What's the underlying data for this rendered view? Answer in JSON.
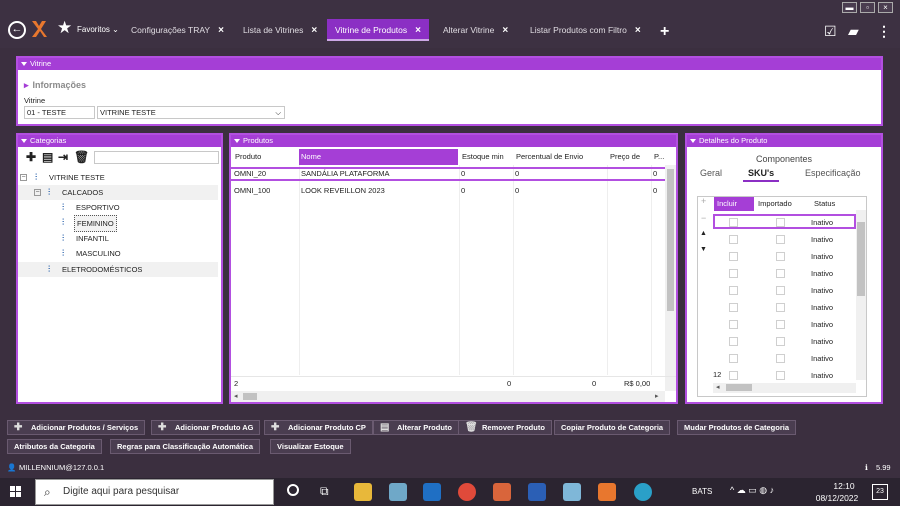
{
  "tabs": {
    "favorites": "Favoritos",
    "items": [
      {
        "label": "Configurações TRAY",
        "close": "×"
      },
      {
        "label": "Lista de Vitrines",
        "close": "×"
      },
      {
        "label": "Vitrine de Produtos",
        "close": "×"
      },
      {
        "label": "Alterar Vitrine",
        "close": "×"
      },
      {
        "label": "Listar Produtos com Filtro",
        "close": "×"
      }
    ],
    "new_tab": "+"
  },
  "window_controls": {
    "minimize": "▬",
    "restore": "▫",
    "close": "×"
  },
  "vitrine": {
    "header": "Vitrine",
    "section": "Informações",
    "label": "Vitrine",
    "code": "01 - TESTE",
    "name": "VITRINE TESTE",
    "dropdown": "⌵"
  },
  "categorias": {
    "header": "Categorias",
    "tree": {
      "root": "VITRINE TESTE",
      "calcados": "CALCADOS",
      "children": [
        "ESPORTIVO",
        "FEMININO",
        "INFANTIL",
        "MASCULINO"
      ],
      "eletro": "ELETRODOMÉSTICOS"
    }
  },
  "produtos": {
    "header": "Produtos",
    "columns": [
      "Produto",
      "Nome",
      "Estoque min",
      "Percentual de Envio",
      "Preço de",
      "P..."
    ],
    "rows": [
      {
        "produto": "OMNI_20",
        "nome": "SANDÁLIA PLATAFORMA",
        "estoque": "0",
        "percentual": "0",
        "p": "0"
      },
      {
        "produto": "OMNI_100",
        "nome": "LOOK REVEILLON 2023",
        "estoque": "0",
        "percentual": "0",
        "p": "0"
      }
    ],
    "footer": {
      "count": "2",
      "estoque": "0",
      "percentual": "0",
      "preco": "R$ 0,00"
    }
  },
  "detalhes": {
    "header": "Detalhes do Produto",
    "componentes": "Componentes",
    "tabs": [
      "Geral",
      "SKU's",
      "Especificação"
    ],
    "columns": [
      "Incluir",
      "Importado",
      "Status"
    ],
    "status_rows": [
      "Inativo",
      "Inativo",
      "Inativo",
      "Inativo",
      "Inativo",
      "Inativo",
      "Inativo",
      "Inativo",
      "Inativo",
      "Inativo"
    ],
    "count": "12",
    "side_buttons": {
      "add": "+",
      "remove": "−",
      "up": "▲",
      "down": "▼"
    }
  },
  "buttons_row1": [
    "Adicionar Produtos / Serviços",
    "Adicionar Produto AG",
    "Adicionar Produto CP",
    "Alterar Produto",
    "Remover Produto",
    "Copiar Produto de Categoria",
    "Mudar Produtos de Categoria"
  ],
  "buttons_row2": [
    "Atributos da Categoria",
    "Regras para Classificação Automática",
    "Visualizar Estoque"
  ],
  "status": {
    "user": "MILLENNIUM@127.0.0.1",
    "version": "5.99"
  },
  "taskbar": {
    "search_placeholder": "Digite aqui para pesquisar",
    "bats": "BATS",
    "time": "12:10",
    "date": "08/12/2022",
    "notifications": "23"
  }
}
